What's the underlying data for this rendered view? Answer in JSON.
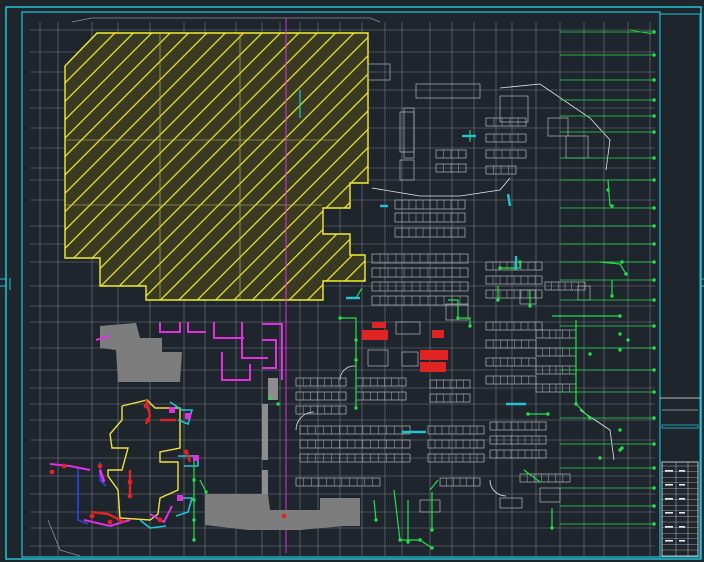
{
  "drawing": {
    "background": "#1f252c",
    "frame_color": "#22c3d6",
    "grid_color": "#8a9099",
    "hatch_fill_color": "#f2ee2a",
    "magenta_color": "#e030e0",
    "red_color": "#e02424",
    "green_color": "#22e04a",
    "cyan_color": "#22c3d6",
    "yellow_outline_color": "#f0e040",
    "blue_color": "#2848e0",
    "gray_fill_color": "#7d7d7d",
    "white_color": "#e8e8e8"
  },
  "title_block": {
    "label_lines": 6
  }
}
